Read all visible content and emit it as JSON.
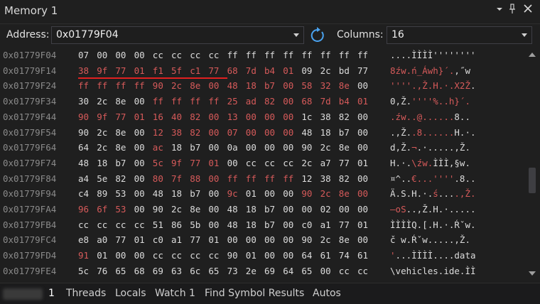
{
  "window": {
    "title": "Memory 1"
  },
  "toolbar": {
    "address_label": "Address:",
    "address_value": "0x01779F04",
    "columns_label": "Columns:",
    "columns_value": "16"
  },
  "rows": [
    {
      "addr": "0x01779F04",
      "bytes": [
        "07",
        "00",
        "00",
        "00",
        "cc",
        "cc",
        "cc",
        "cc",
        "ff",
        "ff",
        "ff",
        "ff",
        "ff",
        "ff",
        "ff",
        "ff"
      ],
      "changed": [],
      "ascii": "....ÌÌÌÌ''''''''",
      "ascii_changed": []
    },
    {
      "addr": "0x01779F14",
      "bytes": [
        "38",
        "9f",
        "77",
        "01",
        "f1",
        "5f",
        "c1",
        "77",
        "68",
        "7d",
        "b4",
        "01",
        "09",
        "2c",
        "bd",
        "77"
      ],
      "changed": [
        0,
        1,
        2,
        3,
        4,
        5,
        6,
        7,
        8,
        9,
        10,
        11
      ],
      "ascii": "8źw.ń_Áwh}´.,˝w",
      "ascii_changed": [
        0,
        1,
        2,
        3,
        4,
        5,
        6,
        7,
        8,
        9,
        10,
        11
      ]
    },
    {
      "addr": "0x01779F24",
      "bytes": [
        "ff",
        "ff",
        "ff",
        "ff",
        "90",
        "2c",
        "8e",
        "00",
        "48",
        "18",
        "b7",
        "00",
        "58",
        "32",
        "8e",
        "00"
      ],
      "changed": [
        0,
        1,
        2,
        3,
        4,
        5,
        6,
        7,
        8,
        9,
        10,
        11,
        12,
        13,
        14
      ],
      "ascii": "''''.,Ž.H.·.X2Ž.",
      "ascii_changed": [
        0,
        1,
        2,
        3,
        4,
        5,
        6,
        7,
        8,
        9,
        10,
        11,
        12,
        13,
        14
      ]
    },
    {
      "addr": "0x01779F34",
      "bytes": [
        "30",
        "2c",
        "8e",
        "00",
        "ff",
        "ff",
        "ff",
        "ff",
        "25",
        "ad",
        "82",
        "00",
        "68",
        "7d",
        "b4",
        "01"
      ],
      "changed": [
        4,
        5,
        6,
        7,
        8,
        9,
        10,
        11,
        12,
        13,
        14,
        15
      ],
      "ascii": "0,Ž.''''%­..h}´.",
      "ascii_changed": [
        4,
        5,
        6,
        7,
        8,
        9,
        10,
        11,
        12,
        13,
        14,
        15
      ]
    },
    {
      "addr": "0x01779F44",
      "bytes": [
        "90",
        "9f",
        "77",
        "01",
        "16",
        "40",
        "82",
        "00",
        "13",
        "00",
        "00",
        "00",
        "1c",
        "38",
        "82",
        "00"
      ],
      "changed": [
        0,
        1,
        2,
        3,
        4,
        5,
        6,
        7,
        8,
        9,
        10,
        11
      ],
      "ascii": ".źw..@......8..",
      "ascii_changed": [
        0,
        1,
        2,
        3,
        4,
        5,
        6,
        7,
        8,
        9,
        10,
        11
      ]
    },
    {
      "addr": "0x01779F54",
      "bytes": [
        "90",
        "2c",
        "8e",
        "00",
        "12",
        "38",
        "82",
        "00",
        "07",
        "00",
        "00",
        "00",
        "48",
        "18",
        "b7",
        "00"
      ],
      "changed": [
        4,
        5,
        6,
        7,
        8,
        9,
        10,
        11
      ],
      "ascii": ".,Ž..8......H.·.",
      "ascii_changed": [
        4,
        5,
        6,
        7,
        8,
        9,
        10,
        11
      ]
    },
    {
      "addr": "0x01779F64",
      "bytes": [
        "64",
        "2c",
        "8e",
        "00",
        "ac",
        "18",
        "b7",
        "00",
        "0a",
        "00",
        "00",
        "00",
        "90",
        "2c",
        "8e",
        "00"
      ],
      "changed": [
        4
      ],
      "ascii": "d,Ž.¬.·.....,Ž.",
      "ascii_changed": [
        4
      ]
    },
    {
      "addr": "0x01779F74",
      "bytes": [
        "48",
        "18",
        "b7",
        "00",
        "5c",
        "9f",
        "77",
        "01",
        "00",
        "cc",
        "cc",
        "cc",
        "2c",
        "a7",
        "77",
        "01"
      ],
      "changed": [
        4,
        5,
        6,
        7
      ],
      "ascii": "H.·.\\źw.ÌÌÌ,§w.",
      "ascii_changed": [
        4,
        5,
        6,
        7
      ]
    },
    {
      "addr": "0x01779F84",
      "bytes": [
        "a4",
        "5e",
        "82",
        "00",
        "80",
        "7f",
        "88",
        "00",
        "ff",
        "ff",
        "ff",
        "ff",
        "12",
        "38",
        "82",
        "00"
      ],
      "changed": [
        4,
        5,
        6,
        7,
        8,
        9,
        10,
        11
      ],
      "ascii": "¤^..€...''''.8..",
      "ascii_changed": [
        4,
        5,
        6,
        7,
        8,
        9,
        10,
        11
      ]
    },
    {
      "addr": "0x01779F94",
      "bytes": [
        "c4",
        "89",
        "53",
        "00",
        "48",
        "18",
        "b7",
        "00",
        "9c",
        "01",
        "00",
        "00",
        "90",
        "2c",
        "8e",
        "00"
      ],
      "changed": [
        8,
        12,
        13,
        14,
        15
      ],
      "ascii": "Ä.S.H.·.ś....,Ž.",
      "ascii_changed": [
        8,
        12,
        13,
        14,
        15
      ]
    },
    {
      "addr": "0x01779FA4",
      "bytes": [
        "96",
        "6f",
        "53",
        "00",
        "90",
        "2c",
        "8e",
        "00",
        "48",
        "18",
        "b7",
        "00",
        "00",
        "02",
        "00",
        "00"
      ],
      "changed": [
        0,
        1,
        2
      ],
      "ascii": "–oS..,Ž.H.·.....",
      "ascii_changed": [
        0,
        1,
        2
      ]
    },
    {
      "addr": "0x01779FB4",
      "bytes": [
        "cc",
        "cc",
        "cc",
        "cc",
        "51",
        "86",
        "5b",
        "00",
        "48",
        "18",
        "b7",
        "00",
        "c0",
        "a1",
        "77",
        "01"
      ],
      "changed": [],
      "ascii": "ÌÌÌÌQ.[.H.·.Ŕˇw.",
      "ascii_changed": []
    },
    {
      "addr": "0x01779FC4",
      "bytes": [
        "e8",
        "a0",
        "77",
        "01",
        "c0",
        "a1",
        "77",
        "01",
        "00",
        "00",
        "00",
        "00",
        "90",
        "2c",
        "8e",
        "00"
      ],
      "changed": [],
      "ascii": "č w.Ŕˇw.....,Ž.",
      "ascii_changed": []
    },
    {
      "addr": "0x01779FD4",
      "bytes": [
        "91",
        "01",
        "00",
        "00",
        "cc",
        "cc",
        "cc",
        "cc",
        "90",
        "01",
        "00",
        "00",
        "64",
        "61",
        "74",
        "61"
      ],
      "changed": [
        0
      ],
      "ascii": "'...ÌÌÌÌ....data",
      "ascii_changed": [
        0
      ]
    },
    {
      "addr": "0x01779FE4",
      "bytes": [
        "5c",
        "76",
        "65",
        "68",
        "69",
        "63",
        "6c",
        "65",
        "73",
        "2e",
        "69",
        "64",
        "65",
        "00",
        "cc",
        "cc"
      ],
      "changed": [],
      "ascii": "\\vehicles.ide.ÌÌ",
      "ascii_changed": []
    }
  ],
  "tabs": [
    {
      "label": "1",
      "active": true
    },
    {
      "label": "Threads",
      "active": false
    },
    {
      "label": "Locals",
      "active": false
    },
    {
      "label": "Watch 1",
      "active": false
    },
    {
      "label": "Find Symbol Results",
      "active": false
    },
    {
      "label": "Autos",
      "active": false
    }
  ],
  "colors": {
    "changed": "#d65a5a",
    "normal": "#dcdcdc",
    "address": "#8a8a8a",
    "underline": "#e02020"
  },
  "icons": [
    "dropdown-icon",
    "pin-icon",
    "close-icon",
    "refresh-icon",
    "chevron-down-icon"
  ]
}
